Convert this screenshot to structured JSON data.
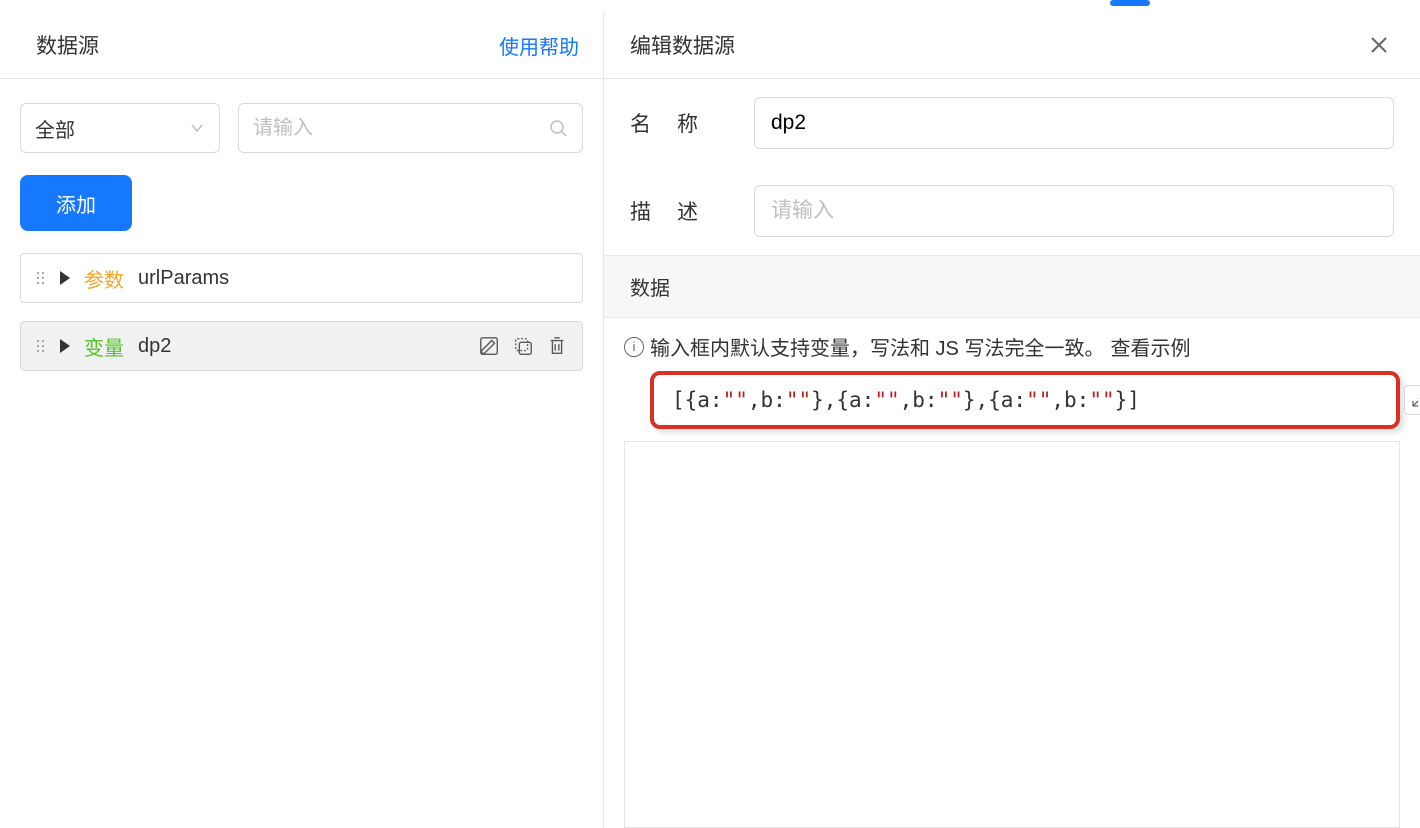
{
  "left": {
    "title": "数据源",
    "help_label": "使用帮助",
    "filter": {
      "select_value": "全部",
      "search_placeholder": "请输入"
    },
    "add_button": "添加",
    "items": [
      {
        "type_label": "参数",
        "type_class": "param",
        "name": "urlParams",
        "selected": false
      },
      {
        "type_label": "变量",
        "type_class": "var",
        "name": "dp2",
        "selected": true
      }
    ]
  },
  "right": {
    "title": "编辑数据源",
    "fields": {
      "name_label": "名称",
      "name_value": "dp2",
      "desc_label": "描述",
      "desc_placeholder": "请输入"
    },
    "data_section_label": "数据",
    "hint_text": "输入框内默认支持变量，写法和 JS 写法完全一致。",
    "hint_link": "查看示例",
    "code_value": "[{a:\"\",b:\"\"},{a:\"\",b:\"\"},{a:\"\",b:\"\"}]"
  }
}
